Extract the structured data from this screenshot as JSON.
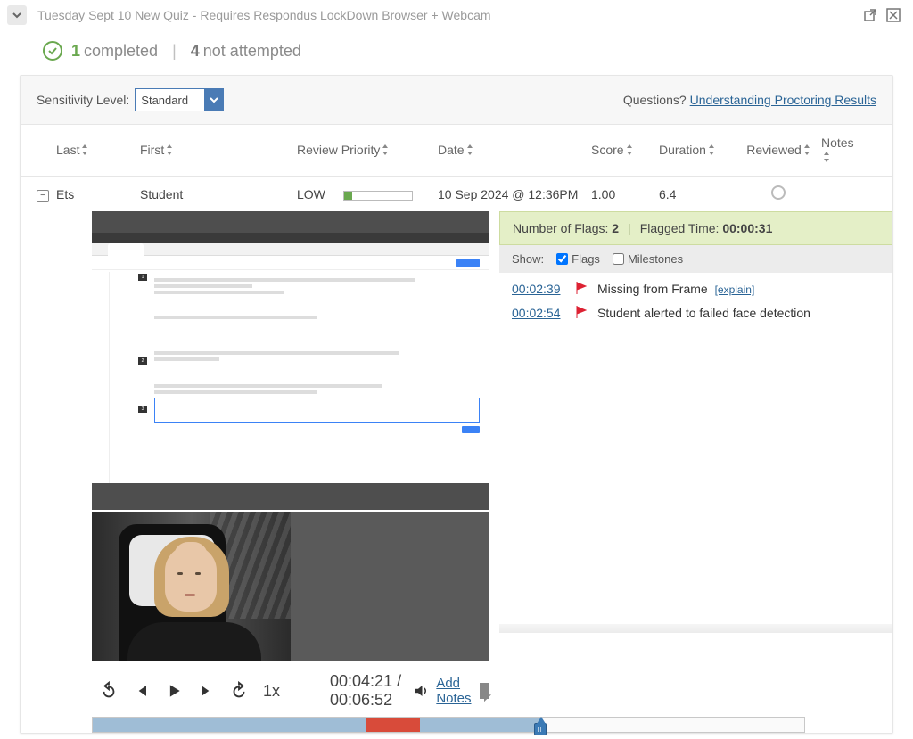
{
  "titlebar": {
    "title": "Tuesday Sept 10 New Quiz - Requires Respondus LockDown Browser + Webcam"
  },
  "status": {
    "completed_count": "1",
    "completed_label": "completed",
    "not_attempted_count": "4",
    "not_attempted_label": "not attempted"
  },
  "toolbar": {
    "sensitivity_label": "Sensitivity Level:",
    "sensitivity_value": "Standard",
    "questions_text": "Questions?",
    "help_link": "Understanding Proctoring Results"
  },
  "columns": {
    "last": "Last",
    "first": "First",
    "priority": "Review Priority",
    "date": "Date",
    "score": "Score",
    "duration": "Duration",
    "reviewed": "Reviewed",
    "notes": "Notes"
  },
  "row": {
    "last": "Ets",
    "first": "Student",
    "priority": "LOW",
    "date": "10 Sep 2024 @ 12:36PM",
    "score": "1.00",
    "duration": "6.4"
  },
  "flags_panel": {
    "num_label": "Number of Flags:",
    "num_value": "2",
    "time_label": "Flagged Time:",
    "time_value": "00:00:31",
    "show_label": "Show:",
    "flags_option": "Flags",
    "milestones_option": "Milestones",
    "events": [
      {
        "time": "00:02:39",
        "text": "Missing from Frame",
        "explain": "[explain]"
      },
      {
        "time": "00:02:54",
        "text": "Student alerted to failed face detection",
        "explain": ""
      }
    ]
  },
  "player": {
    "speed": "1x",
    "current": "00:04:21",
    "total": "00:06:52",
    "add_notes": "Add Notes"
  }
}
